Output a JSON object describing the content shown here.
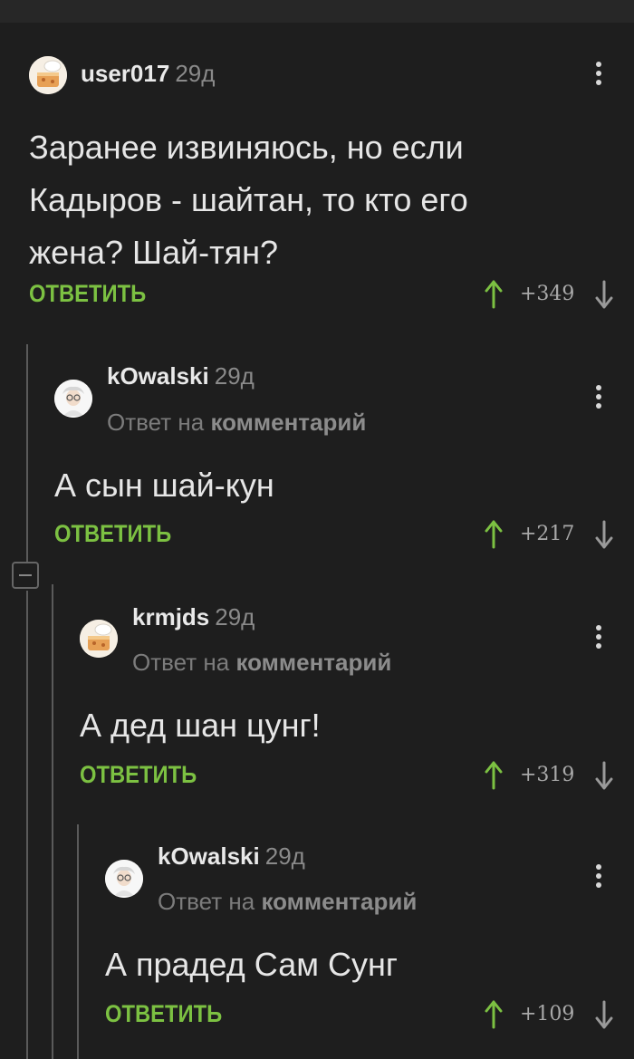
{
  "comments": [
    {
      "username": "user017",
      "time": "29д",
      "reply_to": null,
      "text": [
        "Заранее извиняюсь, но если",
        "Кадыров - шайтан, то кто его",
        "жена? Шай-тян?"
      ],
      "reply_label": "ОТВЕТИТЬ",
      "score": "+349",
      "avatar": "cake-icon"
    },
    {
      "username": "kOwalski",
      "time": "29д",
      "reply_to": {
        "prefix": "Ответ на",
        "link": "комментарий"
      },
      "text": [
        "А сын шай-кун"
      ],
      "reply_label": "ОТВЕТИТЬ",
      "score": "+217",
      "avatar": "scientist-icon"
    },
    {
      "username": "krmjds",
      "time": "29д",
      "reply_to": {
        "prefix": "Ответ на",
        "link": "комментарий"
      },
      "text": [
        "А дед шан цунг!"
      ],
      "reply_label": "ОТВЕТИТЬ",
      "score": "+319",
      "avatar": "cake-icon"
    },
    {
      "username": "kOwalski",
      "time": "29д",
      "reply_to": {
        "prefix": "Ответ на",
        "link": "комментарий"
      },
      "text": [
        "А прадед Сам Сунг"
      ],
      "reply_label": "ОТВЕТИТЬ",
      "score": "+109",
      "avatar": "scientist-icon"
    }
  ],
  "colors": {
    "background": "#1e1e1e",
    "accent_green": "#7cc142",
    "text": "#e6e6e6",
    "muted": "#8a8a8a"
  }
}
